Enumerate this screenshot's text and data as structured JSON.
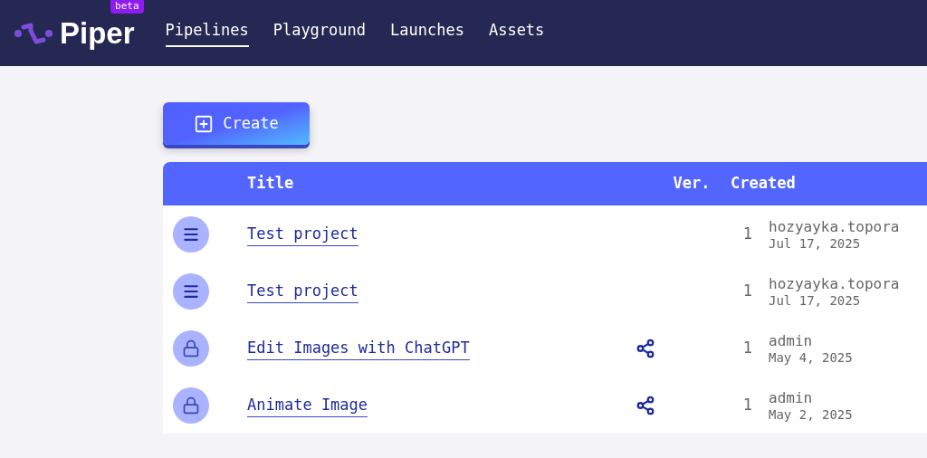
{
  "header": {
    "logo": "Piper",
    "badge": "beta",
    "nav": [
      {
        "label": "Pipelines",
        "selected": true
      },
      {
        "label": "Playground",
        "selected": false
      },
      {
        "label": "Launches",
        "selected": false
      },
      {
        "label": "Assets",
        "selected": false
      }
    ]
  },
  "create_button": "Create",
  "table": {
    "columns": [
      "Title",
      "Ver.",
      "Created"
    ],
    "rows": [
      {
        "kind": "menu",
        "title": "Test project",
        "shared": false,
        "version": "1",
        "author": "hozyayka.topora",
        "date": "Jul 17, 2025"
      },
      {
        "kind": "menu",
        "title": "Test project",
        "shared": false,
        "version": "1",
        "author": "hozyayka.topora",
        "date": "Jul 17, 2025"
      },
      {
        "kind": "locked",
        "title": "Edit Images with ChatGPT",
        "shared": true,
        "version": "1",
        "author": "admin",
        "date": "May 4, 2025"
      },
      {
        "kind": "locked",
        "title": "Animate Image",
        "shared": true,
        "version": "1",
        "author": "admin",
        "date": "May 2, 2025"
      }
    ]
  }
}
